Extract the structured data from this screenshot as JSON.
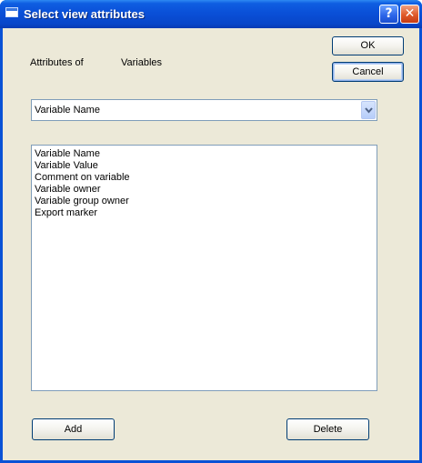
{
  "window": {
    "title": "Select view attributes"
  },
  "labels": {
    "attributes_of": "Attributes of",
    "target": "Variables"
  },
  "buttons": {
    "ok": "OK",
    "cancel": "Cancel",
    "add": "Add",
    "delete": "Delete"
  },
  "combo": {
    "selected": "Variable Name"
  },
  "list": {
    "items": [
      "Variable Name",
      "Variable Value",
      "Comment on variable",
      "Variable owner",
      "Variable group owner",
      "Export marker"
    ]
  },
  "icons": {
    "app": "window-icon",
    "help": "help-icon",
    "close": "close-icon",
    "dropdown": "chevron-down-icon"
  },
  "colors": {
    "titlebar": "#0a50d8",
    "client": "#ece9d8",
    "close": "#e05a2a"
  }
}
